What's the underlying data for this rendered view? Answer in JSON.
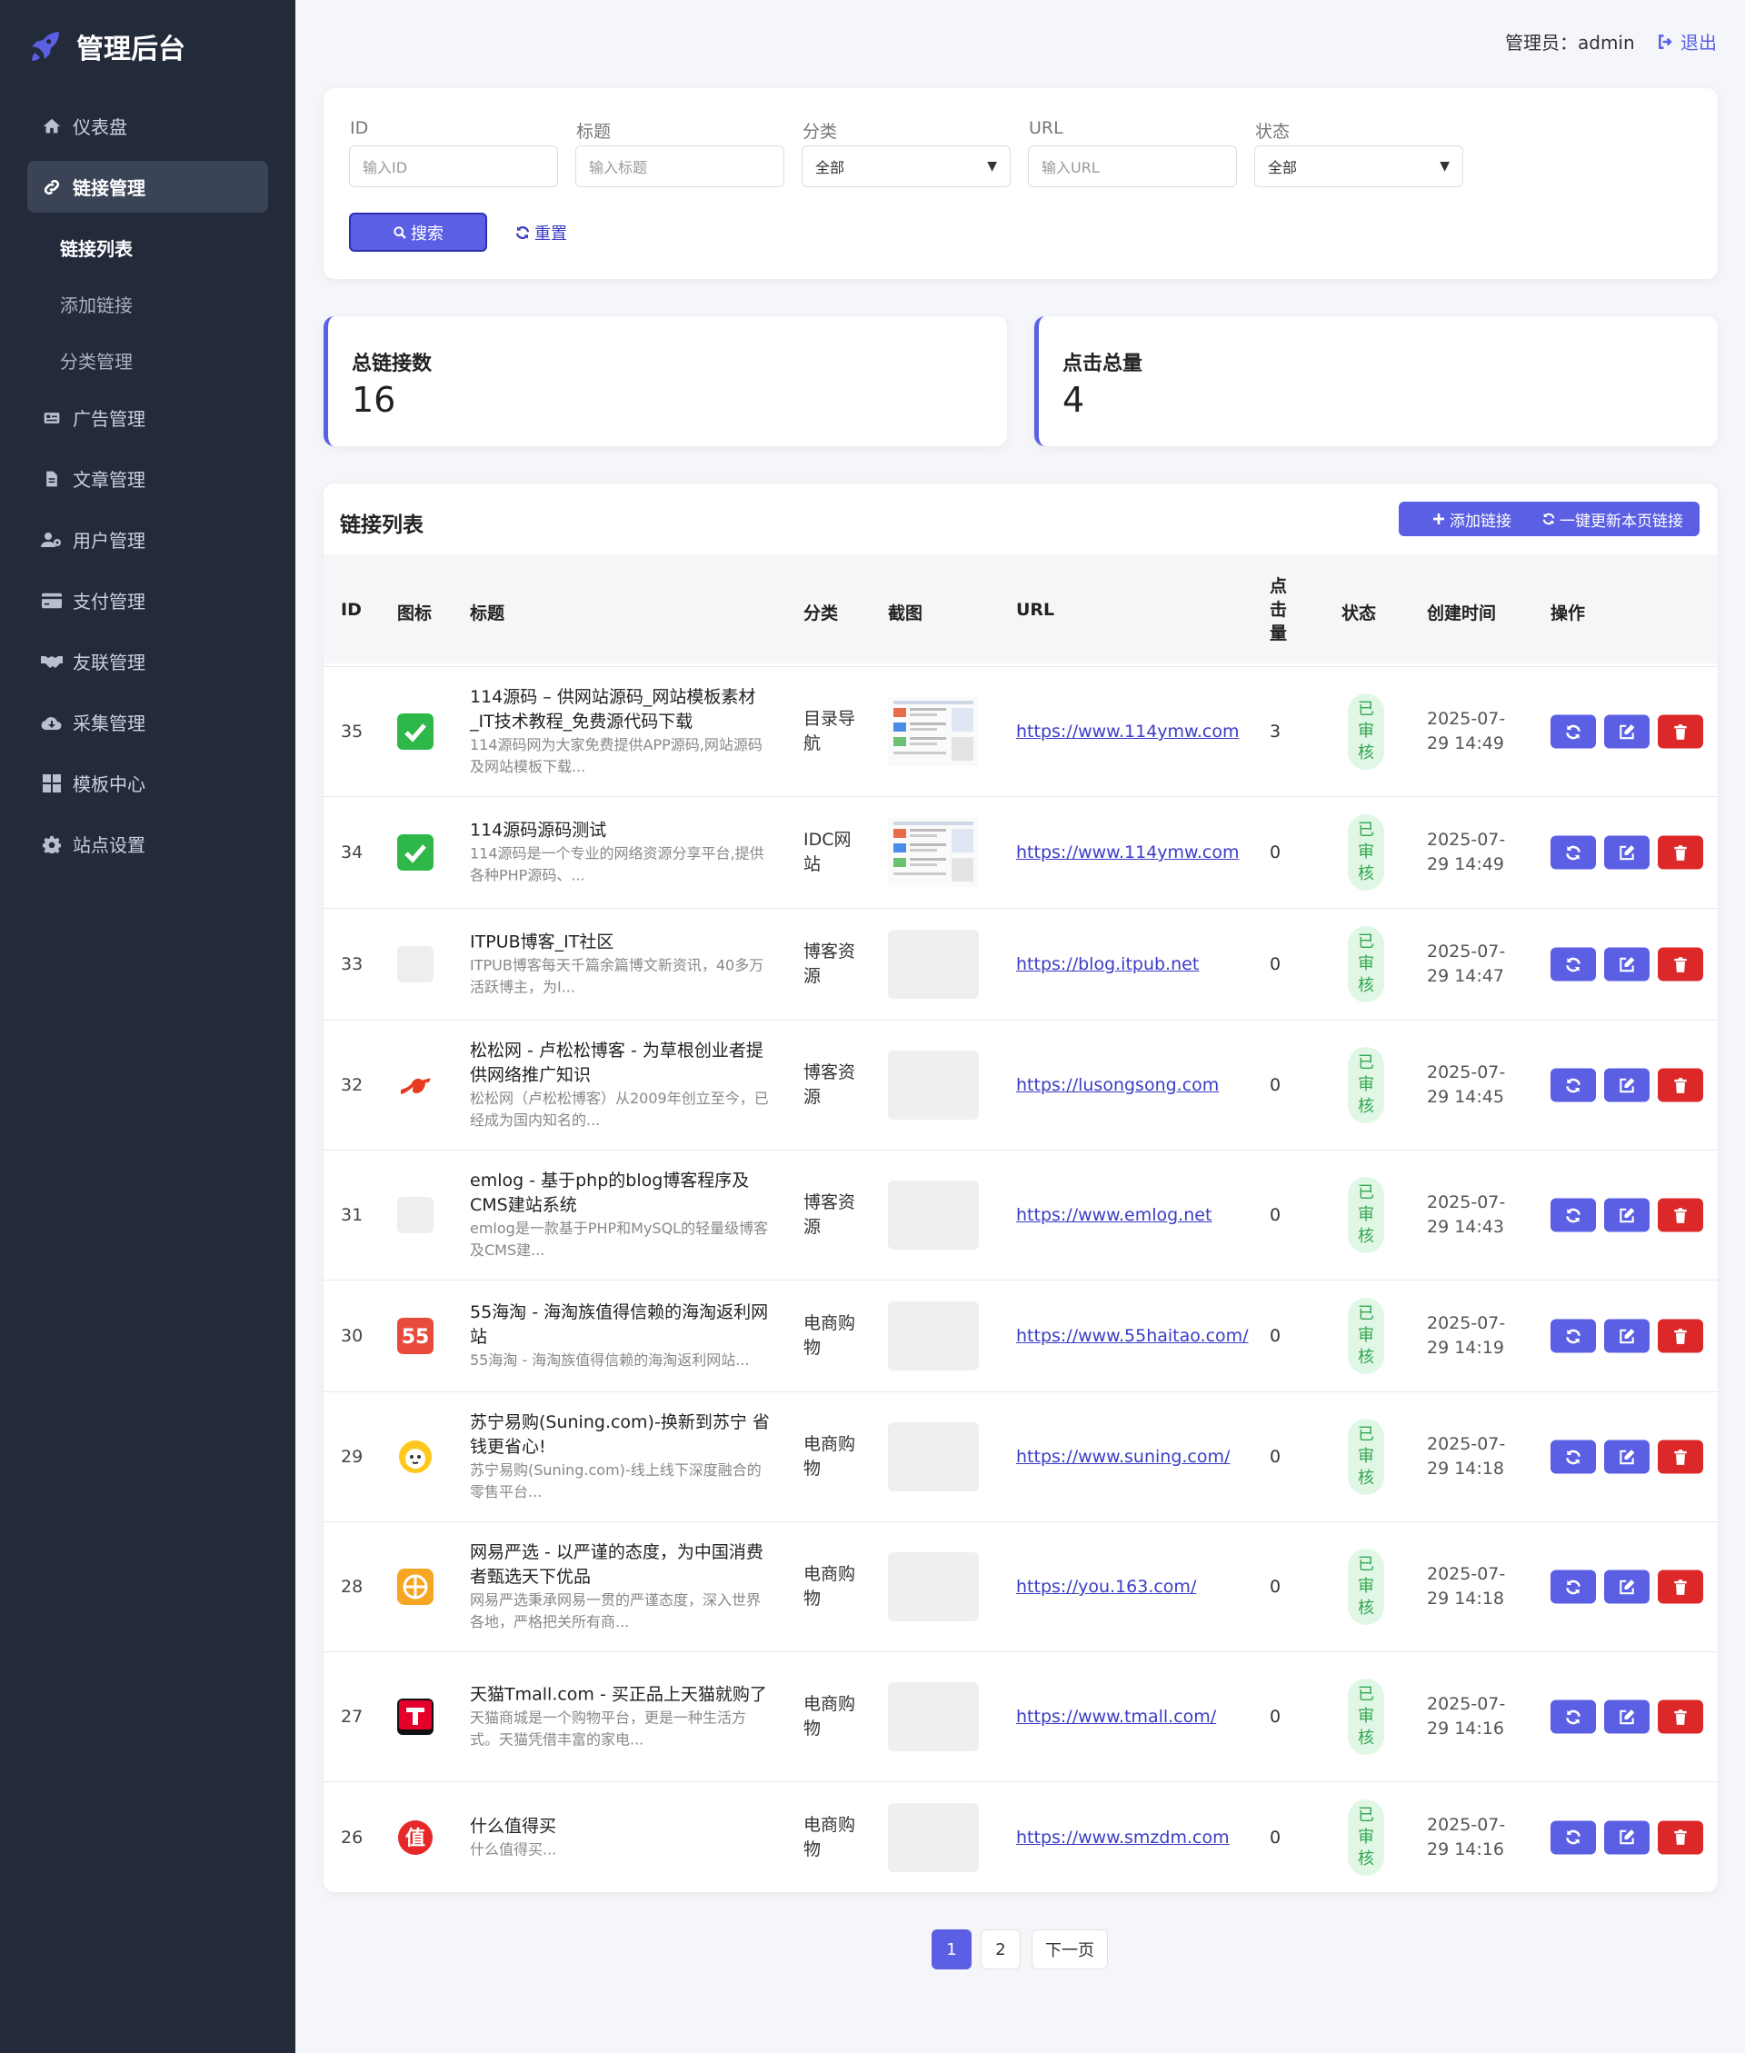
{
  "sidebar": {
    "brand": "管理后台",
    "items": [
      {
        "label": "仪表盘",
        "icon": "home-icon"
      },
      {
        "label": "链接管理",
        "icon": "link-icon"
      },
      {
        "label": "广告管理",
        "icon": "ad-icon"
      },
      {
        "label": "文章管理",
        "icon": "file-icon"
      },
      {
        "label": "用户管理",
        "icon": "users-icon"
      },
      {
        "label": "支付管理",
        "icon": "credit-card-icon"
      },
      {
        "label": "友联管理",
        "icon": "handshake-icon"
      },
      {
        "label": "采集管理",
        "icon": "cloud-download-icon"
      },
      {
        "label": "模板中心",
        "icon": "grid-icon"
      },
      {
        "label": "站点设置",
        "icon": "gear-icon"
      }
    ],
    "subitems": [
      "链接列表",
      "添加链接",
      "分类管理"
    ]
  },
  "header": {
    "admin_label": "管理员：admin",
    "logout_label": "退出"
  },
  "filters": {
    "id_label": "ID",
    "id_placeholder": "输入ID",
    "title_label": "标题",
    "title_placeholder": "输入标题",
    "category_label": "分类",
    "category_value": "全部",
    "url_label": "URL",
    "url_placeholder": "输入URL",
    "status_label": "状态",
    "status_value": "全部",
    "search_label": "搜索",
    "reset_label": "重置"
  },
  "stats": {
    "total_links_label": "总链接数",
    "total_links_value": "16",
    "total_clicks_label": "点击总量",
    "total_clicks_value": "4"
  },
  "table": {
    "title": "链接列表",
    "add_label": "添加链接",
    "refresh_all_label": "一键更新本页链接",
    "headers": [
      "ID",
      "图标",
      "标题",
      "分类",
      "截图",
      "URL",
      "点击量",
      "状态",
      "创建时间",
      "操作"
    ],
    "rows": [
      {
        "id": "35",
        "icon": "check",
        "title": "114源码 – 供网站源码_网站模板素材_IT技术教程_免费源代码下载",
        "desc": "114源码网为大家免费提供APP源码,网站源码及网站模板下载...",
        "category": "目录导航",
        "shot": "screenshot",
        "url": "https://www.114ymw.com",
        "clicks": "3",
        "status": "已审核",
        "time": "2025-07-29 14:49"
      },
      {
        "id": "34",
        "icon": "check",
        "title": "114源码源码测试",
        "desc": "114源码是一个专业的网络资源分享平台,提供各种PHP源码、...",
        "category": "IDC网站",
        "shot": "screenshot",
        "url": "https://www.114ymw.com",
        "clicks": "0",
        "status": "已审核",
        "time": "2025-07-29 14:49"
      },
      {
        "id": "33",
        "icon": "blank",
        "title": "ITPUB博客_IT社区",
        "desc": "ITPUB博客每天千篇余篇博文新资讯，40多万活跃博主，为I...",
        "category": "博客资源",
        "shot": "blank",
        "url": "https://blog.itpub.net",
        "clicks": "0",
        "status": "已审核",
        "time": "2025-07-29 14:47"
      },
      {
        "id": "32",
        "icon": "squirrel",
        "title": "松松网 - 卢松松博客 - 为草根创业者提供网络推广知识",
        "desc": "松松网（卢松松博客）从2009年创立至今，已经成为国内知名的...",
        "category": "博客资源",
        "shot": "blank",
        "url": "https://lusongsong.com",
        "clicks": "0",
        "status": "已审核",
        "time": "2025-07-29 14:45"
      },
      {
        "id": "31",
        "icon": "blank",
        "title": "emlog - 基于php的blog博客程序及CMS建站系统",
        "desc": "emlog是一款基于PHP和MySQL的轻量级博客及CMS建...",
        "category": "博客资源",
        "shot": "blank",
        "url": "https://www.emlog.net",
        "clicks": "0",
        "status": "已审核",
        "time": "2025-07-29 14:43"
      },
      {
        "id": "30",
        "icon": "55",
        "title": "55海淘 - 海淘族值得信赖的海淘返利网站",
        "desc": "55海淘 - 海淘族值得信赖的海淘返利网站...",
        "category": "电商购物",
        "shot": "blank",
        "url": "https://www.55haitao.com/",
        "clicks": "0",
        "status": "已审核",
        "time": "2025-07-29 14:19"
      },
      {
        "id": "29",
        "icon": "suning",
        "title": "苏宁易购(Suning.com)-换新到苏宁 省钱更省心!",
        "desc": "苏宁易购(Suning.com)-线上线下深度融合的零售平台...",
        "category": "电商购物",
        "shot": "blank",
        "url": "https://www.suning.com/",
        "clicks": "0",
        "status": "已审核",
        "time": "2025-07-29 14:18"
      },
      {
        "id": "28",
        "icon": "yanxuan",
        "title": "网易严选 - 以严谨的态度，为中国消费者甄选天下优品",
        "desc": "网易严选秉承网易一贯的严谨态度，深入世界各地，严格把关所有商...",
        "category": "电商购物",
        "shot": "blank",
        "url": "https://you.163.com/",
        "clicks": "0",
        "status": "已审核",
        "time": "2025-07-29 14:18"
      },
      {
        "id": "27",
        "icon": "tmall",
        "title": "天猫Tmall.com - 买正品上天猫就购了",
        "desc": "天猫商城是一个购物平台，更是一种生活方式。天猫凭借丰富的家电...",
        "category": "电商购物",
        "shot": "blank",
        "url": "https://www.tmall.com/",
        "clicks": "0",
        "status": "已审核",
        "time": "2025-07-29 14:16"
      },
      {
        "id": "26",
        "icon": "smzdm",
        "title": "什么值得买",
        "desc": "什么值得买...",
        "category": "电商购物",
        "shot": "blank",
        "url": "https://www.smzdm.com",
        "clicks": "0",
        "status": "已审核",
        "time": "2025-07-29 14:16"
      }
    ]
  },
  "pagination": {
    "pages": [
      "1",
      "2"
    ],
    "next_label": "下一页",
    "current": "1"
  },
  "colors": {
    "sidebar_bg": "#232b3b",
    "accent": "#5b5fe3",
    "danger": "#dc2828",
    "success_bg": "#e0f7e6",
    "success_text": "#33a64f"
  }
}
